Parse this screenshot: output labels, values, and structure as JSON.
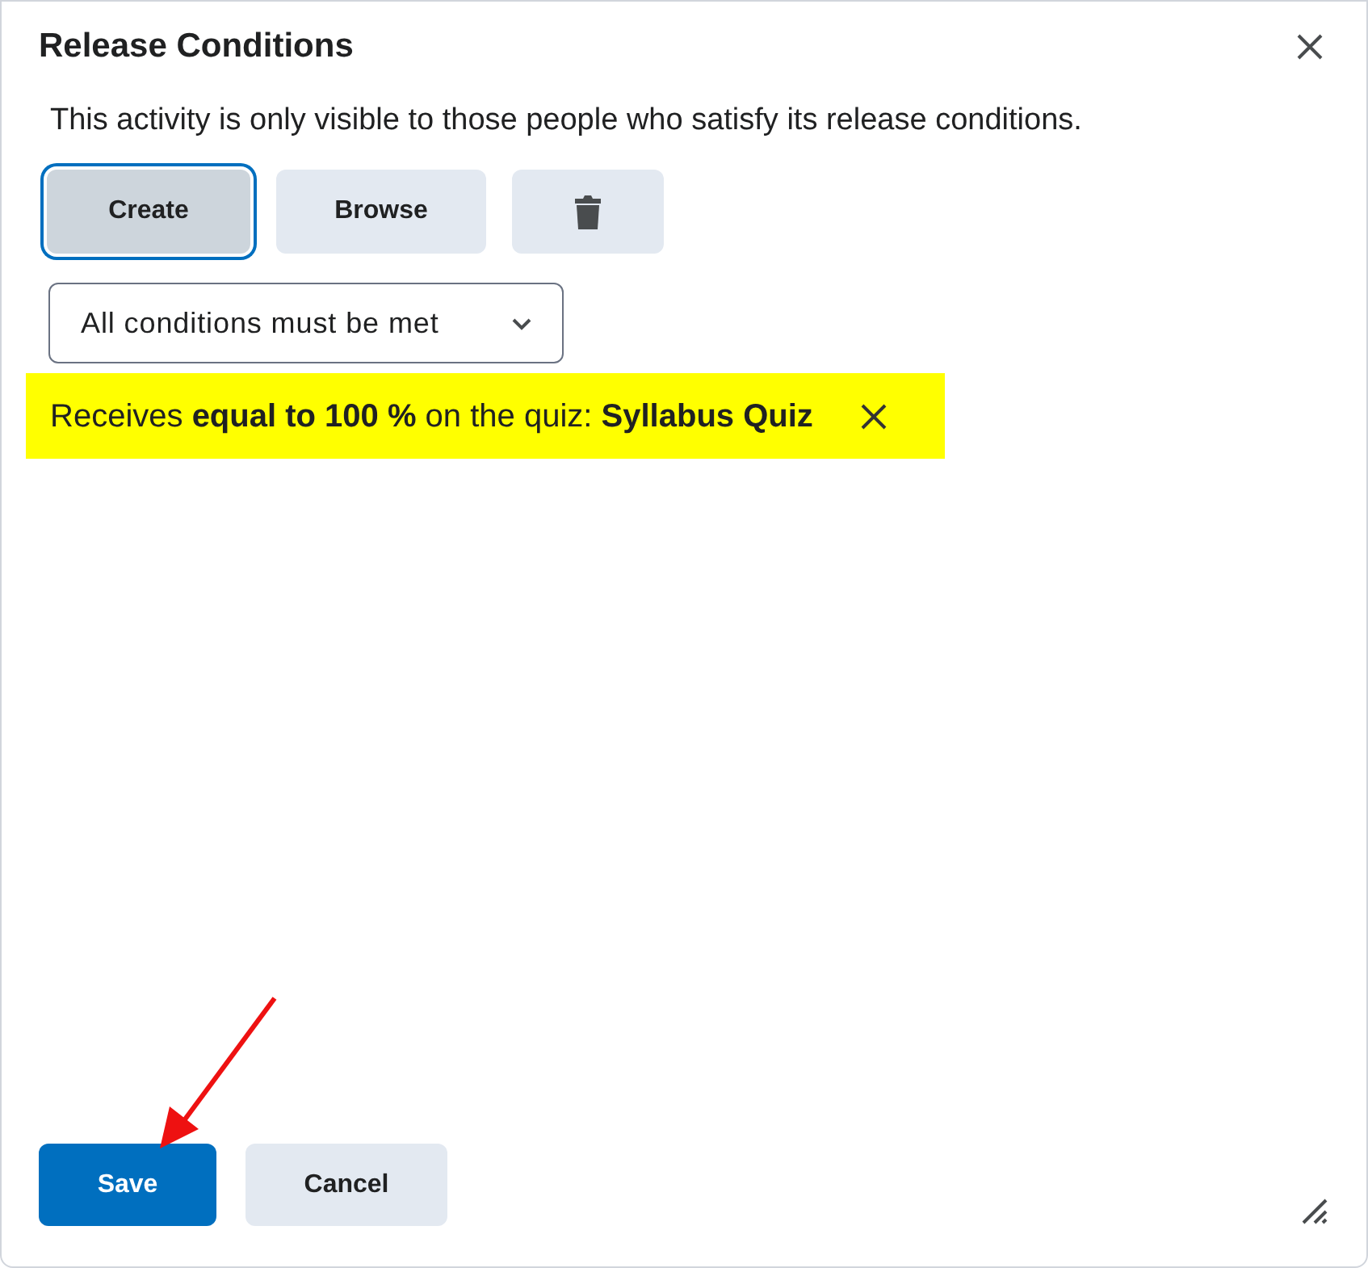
{
  "dialog": {
    "title": "Release Conditions",
    "description": "This activity is only visible to those people who satisfy its release conditions."
  },
  "toolbar": [
    {
      "kind": "text",
      "label": "Create",
      "focused": true
    },
    {
      "kind": "text",
      "label": "Browse",
      "focused": false
    },
    {
      "kind": "delete",
      "focused": false
    }
  ],
  "condition_mode": {
    "value": "All conditions must be met"
  },
  "conditions": [
    {
      "text": "Receives **equal to 100 %** on the quiz: **Syllabus Quiz**",
      "highlighted": true
    }
  ],
  "footer_buttons": [
    {
      "label": "Save",
      "kind": "primary"
    },
    {
      "label": "Cancel",
      "kind": "secondary"
    }
  ]
}
